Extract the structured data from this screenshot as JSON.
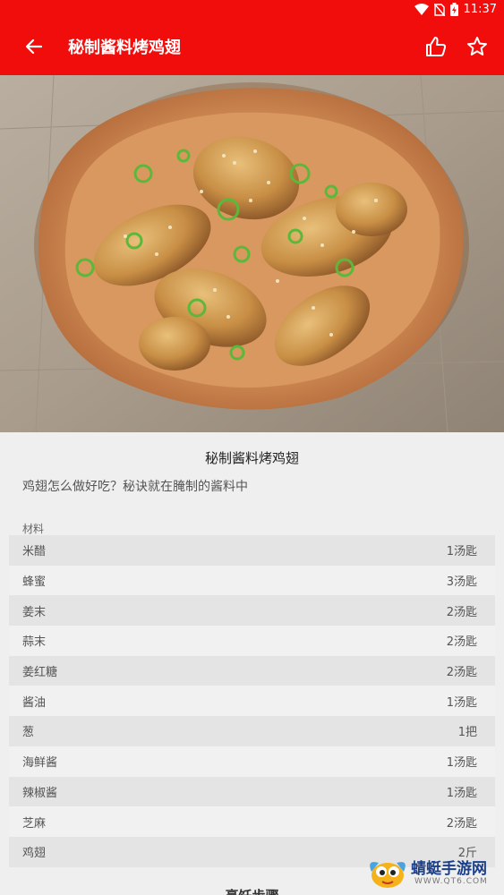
{
  "status_bar": {
    "time": "11:37"
  },
  "app_bar": {
    "title": "秘制酱料烤鸡翅"
  },
  "recipe": {
    "title": "秘制酱料烤鸡翅",
    "description": "鸡翅怎么做好吃？秘诀就在腌制的酱料中",
    "ingredients_label": "材料",
    "ingredients": [
      {
        "name": "米醋",
        "amount": "1汤匙"
      },
      {
        "name": "蜂蜜",
        "amount": "3汤匙"
      },
      {
        "name": "姜末",
        "amount": "2汤匙"
      },
      {
        "name": "蒜末",
        "amount": "2汤匙"
      },
      {
        "name": "姜红糖",
        "amount": "2汤匙"
      },
      {
        "name": "酱油",
        "amount": "1汤匙"
      },
      {
        "name": "葱",
        "amount": "1把"
      },
      {
        "name": "海鲜酱",
        "amount": "1汤匙"
      },
      {
        "name": "辣椒酱",
        "amount": "1汤匙"
      },
      {
        "name": "芝麻",
        "amount": "2汤匙"
      },
      {
        "name": "鸡翅",
        "amount": "2斤"
      }
    ],
    "steps_heading": "烹饪步骤"
  },
  "watermark": {
    "name": "蜻蜓手游网",
    "url": "WWW.QT6.COM"
  },
  "colors": {
    "primary": "#f20d0d",
    "background": "#efefef"
  }
}
